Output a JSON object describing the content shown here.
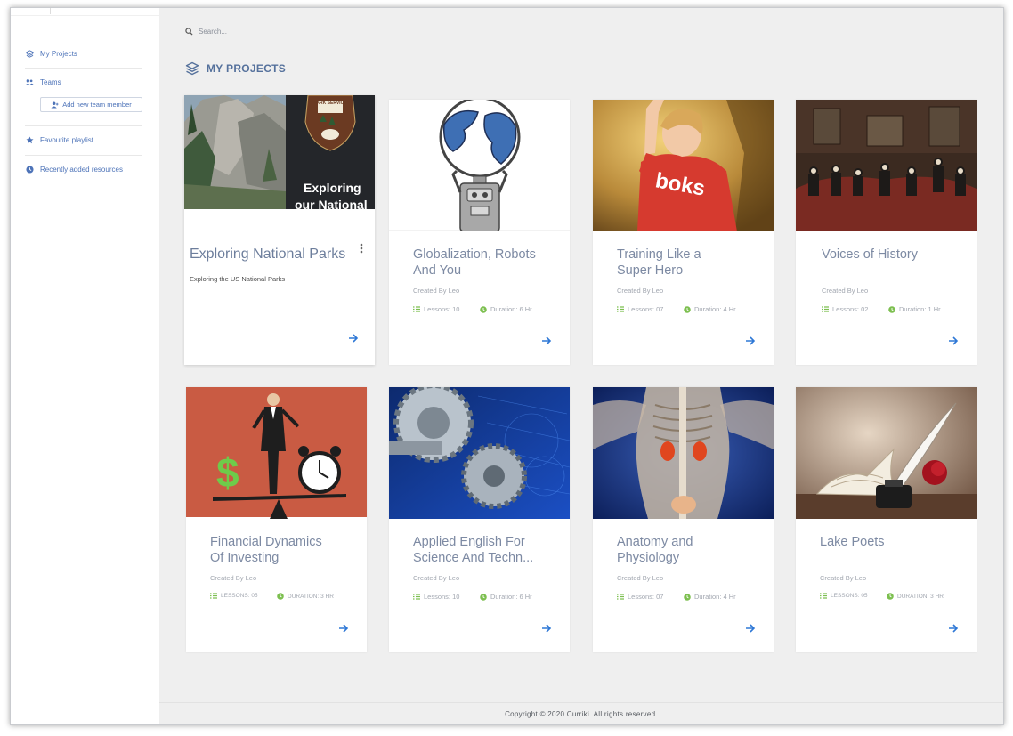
{
  "sidebar": {
    "items": [
      {
        "label": "My Projects",
        "icon": "layers-icon"
      },
      {
        "label": "Teams",
        "icon": "users-icon"
      },
      {
        "label": "Favourite playlist",
        "icon": "star-icon"
      },
      {
        "label": "Recently added resources",
        "icon": "clock-icon"
      }
    ],
    "add_member_label": "Add new team member"
  },
  "search": {
    "placeholder": "Search..."
  },
  "page": {
    "heading": "MY PROJECTS"
  },
  "featured": {
    "title": "Exploring National Parks",
    "description": "Exploring the US National Parks",
    "badge_text": "PARK SERVICE",
    "cover_text_1": "Exploring",
    "cover_text_2": "our National"
  },
  "projects": [
    {
      "title_1": "Globalization, Robots",
      "title_2": "And You",
      "creator": "Created By Leo",
      "lessons": "Lessons: 10",
      "duration": "Duration: 6 Hr"
    },
    {
      "title_1": "Training Like a",
      "title_2": "Super Hero",
      "creator": "Created By Leo",
      "lessons": "Lessons: 07",
      "duration": "Duration: 4 Hr",
      "shirt_text": "boks"
    },
    {
      "title_1": "Voices of History",
      "title_2": "",
      "creator": "Created By Leo",
      "lessons": "Lessons: 02",
      "duration": "Duration: 1 Hr"
    },
    {
      "title_1": "Financial Dynamics",
      "title_2": "Of Investing",
      "creator": "Created By Leo",
      "lessons": "LESSONS: 05",
      "duration": "DURATION: 3 HR"
    },
    {
      "title_1": "Applied English For",
      "title_2": "Science And Techn...",
      "creator": "Created By Leo",
      "lessons": "Lessons: 10",
      "duration": "Duration: 6 Hr"
    },
    {
      "title_1": "Anatomy and",
      "title_2": "Physiology",
      "creator": "Created By Leo",
      "lessons": "Lessons: 07",
      "duration": "Duration: 4 Hr"
    },
    {
      "title_1": "Lake Poets",
      "title_2": "",
      "creator": "Created By Leo",
      "lessons": "LESSONS: 05",
      "duration": "DURATION: 3 HR"
    }
  ],
  "footer": {
    "copyright": "Copyright © 2020 Curriki. All rights reserved."
  },
  "colors": {
    "accent": "#2f78d6",
    "meta_icon_lessons": "#7cbf4f",
    "meta_icon_duration": "#7cbf4f"
  }
}
